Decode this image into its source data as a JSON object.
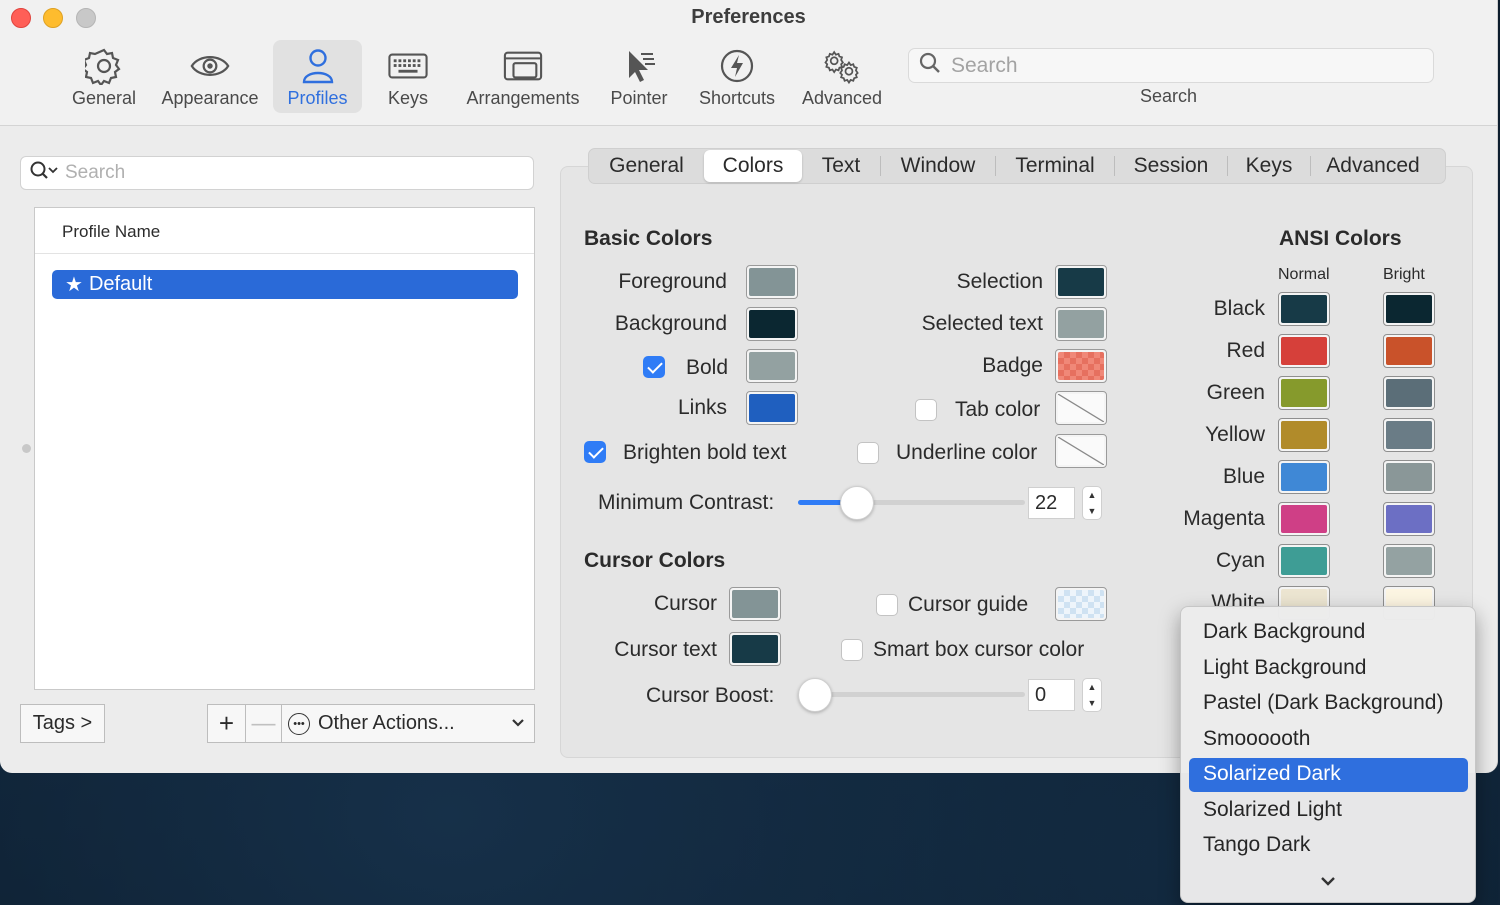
{
  "window": {
    "title": "Preferences"
  },
  "toolbar": {
    "items": [
      {
        "label": "General",
        "icon": "gear-icon"
      },
      {
        "label": "Appearance",
        "icon": "eye-icon"
      },
      {
        "label": "Profiles",
        "icon": "person-icon",
        "active": true
      },
      {
        "label": "Keys",
        "icon": "keyboard-icon"
      },
      {
        "label": "Arrangements",
        "icon": "windows-icon"
      },
      {
        "label": "Pointer",
        "icon": "pointer-icon"
      },
      {
        "label": "Shortcuts",
        "icon": "lightning-icon"
      },
      {
        "label": "Advanced",
        "icon": "gears-icon"
      }
    ],
    "search_placeholder": "Search",
    "search_label": "Search"
  },
  "profiles": {
    "search_placeholder": "Search",
    "column_header": "Profile Name",
    "rows": [
      {
        "name": "Default",
        "starred": true,
        "selected": true
      }
    ],
    "tags_button": "Tags >",
    "add_button": "+",
    "remove_button": "—",
    "other_actions": "Other Actions..."
  },
  "tabs": [
    "General",
    "Colors",
    "Text",
    "Window",
    "Terminal",
    "Session",
    "Keys",
    "Advanced"
  ],
  "selected_tab": "Colors",
  "basic_colors": {
    "title": "Basic Colors",
    "foreground": {
      "label": "Foreground",
      "color": "#839496"
    },
    "background": {
      "label": "Background",
      "color": "#0b2731"
    },
    "bold": {
      "label": "Bold",
      "checked": true,
      "color": "#93a1a1"
    },
    "links": {
      "label": "Links",
      "color": "#1f5fbf"
    },
    "selection": {
      "label": "Selection",
      "color": "#173a47"
    },
    "selected_text": {
      "label": "Selected text",
      "color": "#93a1a1"
    },
    "badge": {
      "label": "Badge",
      "color": "#f08878"
    },
    "tab_color": {
      "label": "Tab color",
      "checked": false
    },
    "underline_color": {
      "label": "Underline color",
      "checked": false
    },
    "brighten_bold": {
      "label": "Brighten bold text",
      "checked": true
    },
    "min_contrast": {
      "label": "Minimum Contrast:",
      "value": "22",
      "level": 0.22
    }
  },
  "cursor_colors": {
    "title": "Cursor Colors",
    "cursor": {
      "label": "Cursor",
      "color": "#839496"
    },
    "cursor_text": {
      "label": "Cursor text",
      "color": "#173a47"
    },
    "cursor_guide": {
      "label": "Cursor guide",
      "checked": false
    },
    "smart_box": {
      "label": "Smart box cursor color",
      "checked": false
    },
    "boost": {
      "label": "Cursor Boost:",
      "value": "0",
      "level": 0
    }
  },
  "ansi": {
    "title": "ANSI Colors",
    "col_normal": "Normal",
    "col_bright": "Bright",
    "rows": [
      {
        "name": "Black",
        "normal": "#173a47",
        "bright": "#0b2731"
      },
      {
        "name": "Red",
        "normal": "#d6403a",
        "bright": "#c9522a"
      },
      {
        "name": "Green",
        "normal": "#869a2c",
        "bright": "#5b6e78"
      },
      {
        "name": "Yellow",
        "normal": "#b18b2a",
        "bright": "#6a7c86"
      },
      {
        "name": "Blue",
        "normal": "#3f88d6",
        "bright": "#8a9798"
      },
      {
        "name": "Magenta",
        "normal": "#cf3f86",
        "bright": "#6c6fc4"
      },
      {
        "name": "Cyan",
        "normal": "#3e9d95",
        "bright": "#94a2a2"
      },
      {
        "name": "White",
        "normal": "#ece5d1",
        "bright": "#fcf5e2"
      }
    ]
  },
  "presets_menu": {
    "items": [
      "Dark Background",
      "Light Background",
      "Pastel (Dark Background)",
      "Smoooooth",
      "Solarized Dark",
      "Solarized Light",
      "Tango Dark"
    ],
    "highlighted": "Solarized Dark"
  }
}
